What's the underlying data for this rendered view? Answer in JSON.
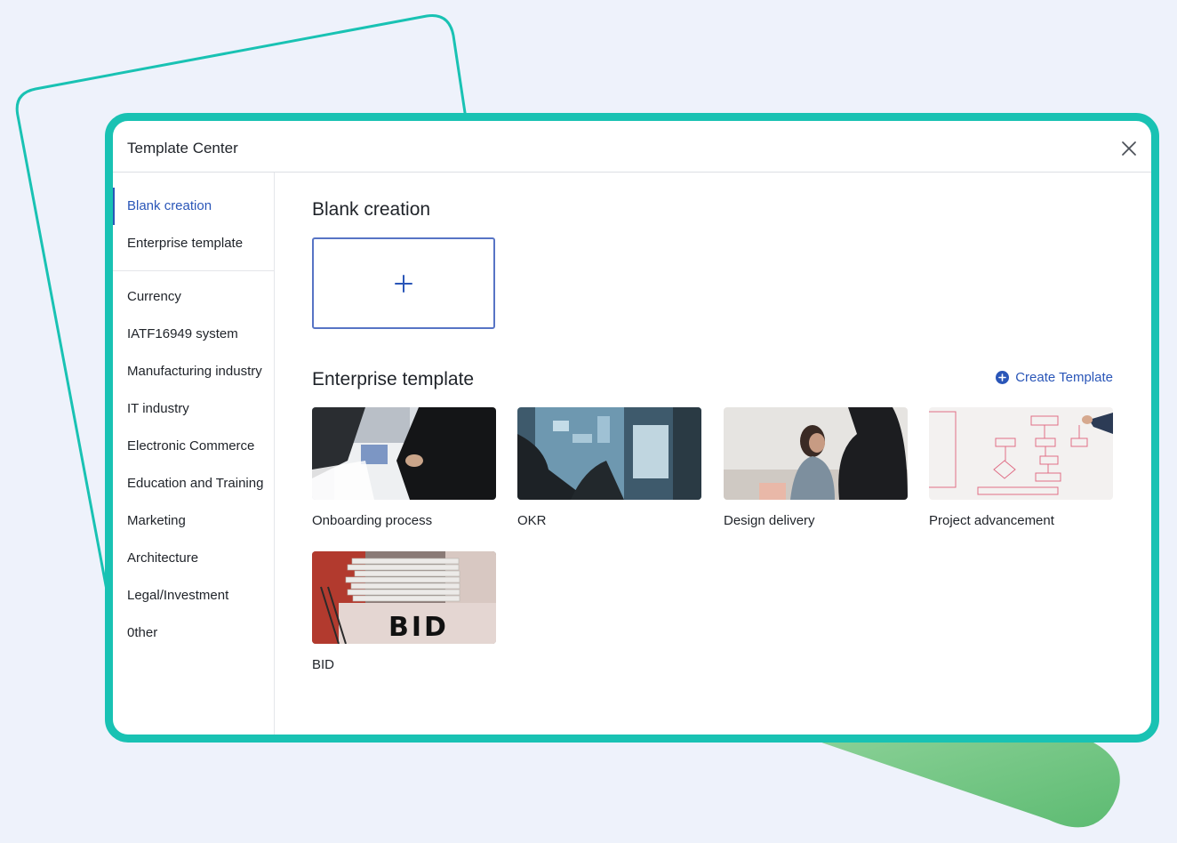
{
  "dialog": {
    "title": "Template Center"
  },
  "sidebar": {
    "primary": [
      {
        "label": "Blank creation",
        "active": true
      },
      {
        "label": "Enterprise template",
        "active": false
      }
    ],
    "categories": [
      {
        "label": "Currency"
      },
      {
        "label": "IATF16949 system"
      },
      {
        "label": "Manufacturing industry"
      },
      {
        "label": "IT industry"
      },
      {
        "label": "Electronic Commerce"
      },
      {
        "label": "Education and Training"
      },
      {
        "label": "Marketing"
      },
      {
        "label": "Architecture"
      },
      {
        "label": "Legal/Investment"
      },
      {
        "label": "0ther"
      }
    ]
  },
  "main": {
    "blank_heading": "Blank creation",
    "enterprise_heading": "Enterprise template",
    "create_template_label": "Create Template",
    "templates": [
      {
        "name": "Onboarding process",
        "thumbnail": "business-meeting-photo"
      },
      {
        "name": "OKR",
        "thumbnail": "data-screen-photo"
      },
      {
        "name": "Design delivery",
        "thumbnail": "office-conversation-photo"
      },
      {
        "name": "Project advancement",
        "thumbnail": "whiteboard-flowchart-photo"
      },
      {
        "name": "BID",
        "thumbnail": "bid-document-stack-photo",
        "overlay_text": "BID"
      }
    ]
  },
  "colors": {
    "frame_accent": "#19c2b3",
    "primary_blue": "#2a56b8",
    "page_background": "#eef2fb",
    "decor_green": "#6cc47e"
  }
}
